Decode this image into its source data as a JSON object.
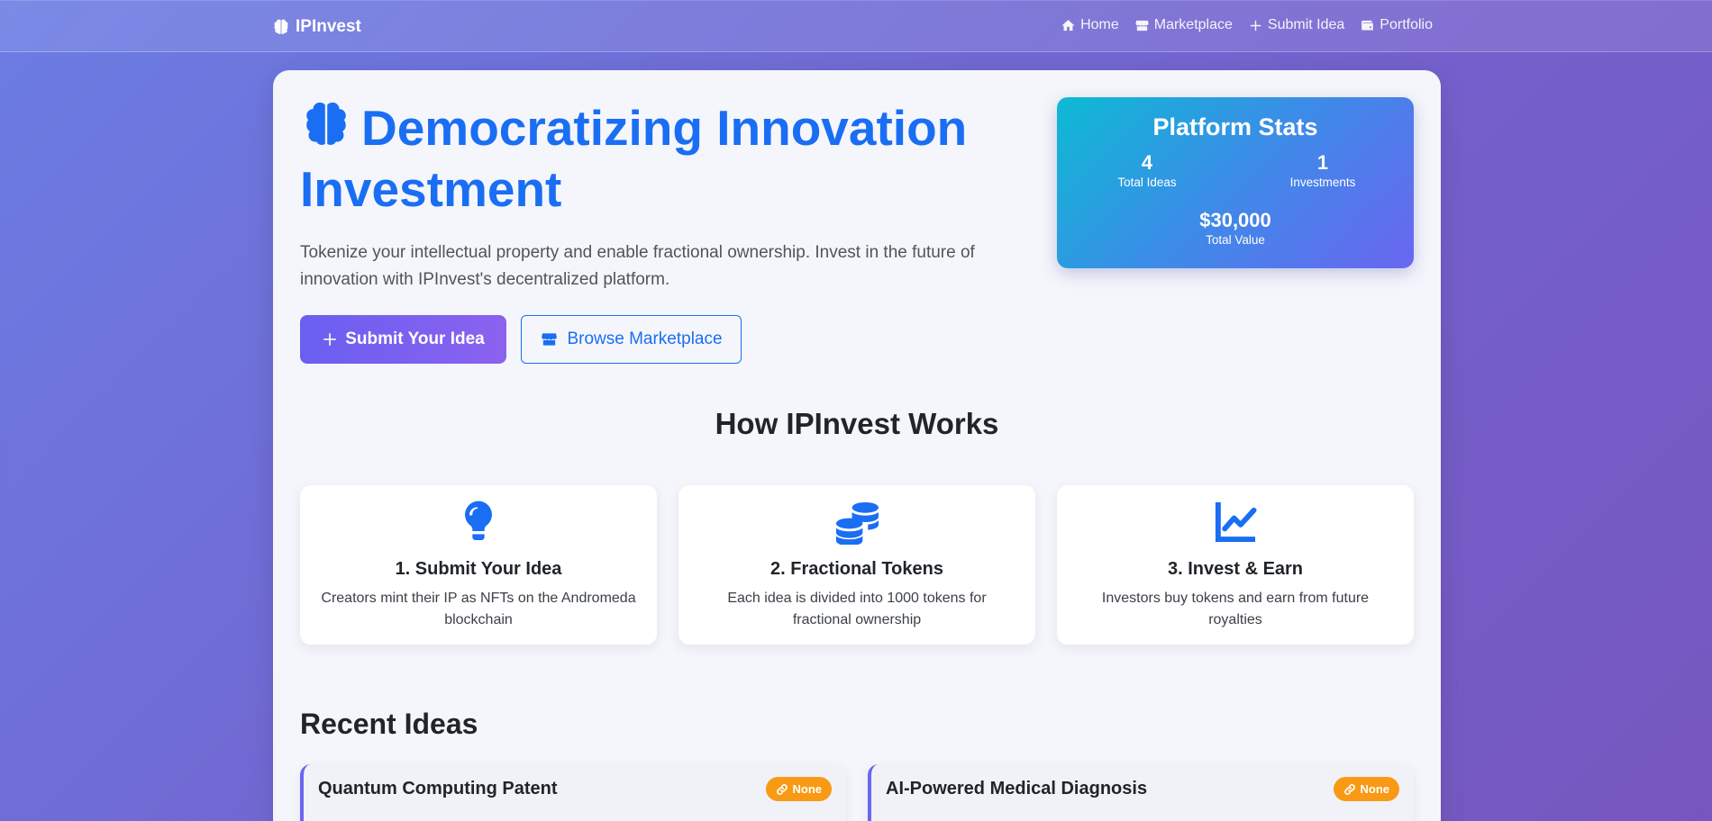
{
  "nav": {
    "brand": "IPInvest",
    "items": [
      {
        "label": "Home",
        "icon": "home-icon"
      },
      {
        "label": "Marketplace",
        "icon": "store-icon"
      },
      {
        "label": "Submit Idea",
        "icon": "plus-icon"
      },
      {
        "label": "Portfolio",
        "icon": "wallet-icon"
      }
    ]
  },
  "hero": {
    "title": "Democratizing Innovation Investment",
    "description": "Tokenize your intellectual property and enable fractional ownership. Invest in the future of innovation with IPInvest's decentralized platform.",
    "primary_button": "Submit Your Idea",
    "secondary_button": "Browse Marketplace"
  },
  "stats": {
    "title": "Platform Stats",
    "total_ideas": {
      "value": "4",
      "label": "Total Ideas"
    },
    "investments": {
      "value": "1",
      "label": "Investments"
    },
    "total_value": {
      "value": "$30,000",
      "label": "Total Value"
    }
  },
  "how": {
    "title": "How IPInvest Works",
    "steps": [
      {
        "title": "1. Submit Your Idea",
        "desc": "Creators mint their IP as NFTs on the Andromeda blockchain",
        "icon": "lightbulb-icon"
      },
      {
        "title": "2. Fractional Tokens",
        "desc": "Each idea is divided into 1000 tokens for fractional ownership",
        "icon": "coins-icon"
      },
      {
        "title": "3. Invest & Earn",
        "desc": "Investors buy tokens and earn from future royalties",
        "icon": "chart-line-icon"
      }
    ]
  },
  "recent": {
    "title": "Recent Ideas",
    "ideas": [
      {
        "name": "Quantum Computing Patent",
        "badge": "None"
      },
      {
        "name": "AI-Powered Medical Diagnosis",
        "badge": "None"
      }
    ]
  },
  "colors": {
    "accent": "#1a6ef3",
    "primary_gradient_start": "#6a5ff1",
    "badge": "#f89a15"
  }
}
